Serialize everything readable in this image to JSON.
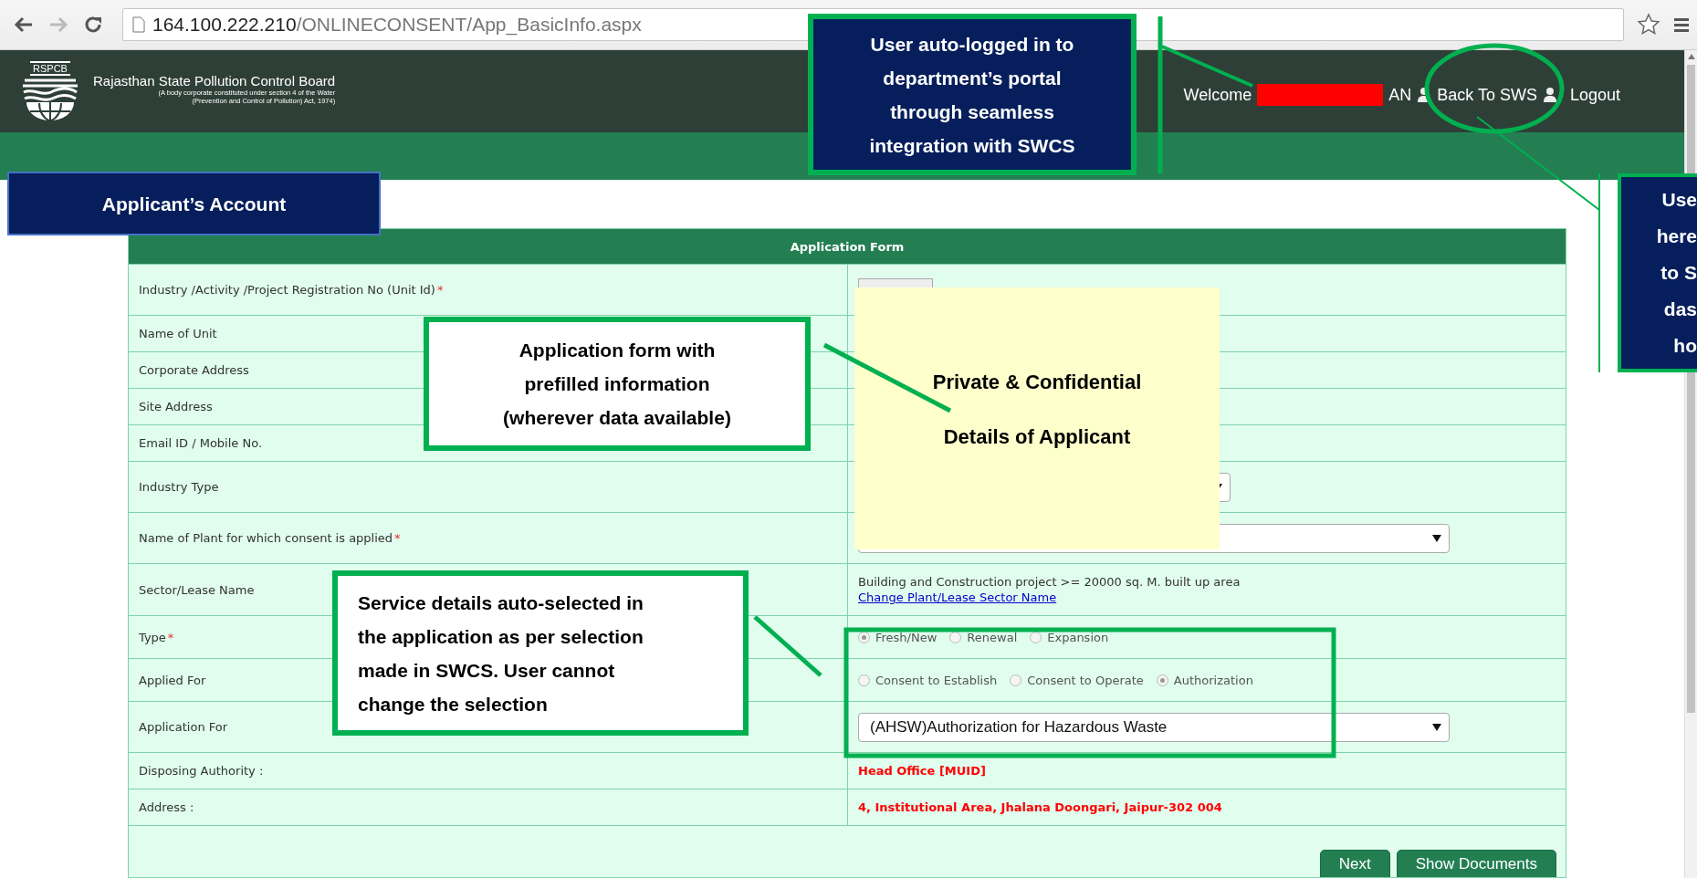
{
  "browser": {
    "url_host": "164.100.222.210",
    "url_path": "/ONLINECONSENT/App_BasicInfo.aspx"
  },
  "header": {
    "logo_text": "RSPCB",
    "org_name": "Rajasthan State Pollution Control Board",
    "org_subtitle_1": "(A body corporate constituted under section 4 of the Water",
    "org_subtitle_2": "(Prevention and Control of Pollution) Act, 1974)",
    "welcome": "Welcome",
    "user_suffix": "AN",
    "back_link": "Back To SWS",
    "logout": "Logout"
  },
  "form": {
    "title": "Application Form",
    "rows": [
      {
        "kind": "input",
        "label": "Industry /Activity /Project Registration No (Unit Id)",
        "required_mark": "*"
      },
      {
        "kind": "blank",
        "label": "Name of Unit"
      },
      {
        "kind": "blank",
        "label": "Corporate Address"
      },
      {
        "kind": "blank",
        "label": "Site Address"
      },
      {
        "kind": "blank",
        "label": "Email ID / Mobile No."
      },
      {
        "kind": "select_short",
        "label": "Industry Type"
      },
      {
        "kind": "select",
        "label": "Name of Plant for which consent is applied",
        "required_mark": "*"
      },
      {
        "kind": "sector",
        "label": "Sector/Lease Name",
        "text": "Building and Construction project >= 20000 sq. M. built up area",
        "link": "Change Plant/Lease Sector Name"
      },
      {
        "kind": "radios",
        "label": "Type",
        "required_mark": "*",
        "options": [
          {
            "label": "Fresh/New",
            "selected": true,
            "disabled": true
          },
          {
            "label": "Renewal",
            "selected": false,
            "disabled": true
          },
          {
            "label": "Expansion",
            "selected": false,
            "disabled": true
          }
        ]
      },
      {
        "kind": "radios",
        "label": "Applied For",
        "options": [
          {
            "label": "Consent to Establish",
            "selected": false,
            "disabled": true
          },
          {
            "label": "Consent to Operate",
            "selected": false,
            "disabled": true
          },
          {
            "label": "Authorization",
            "selected": true,
            "disabled": true
          }
        ]
      },
      {
        "kind": "select",
        "label": "Application For",
        "value": "(AHSW)Authorization for Hazardous Waste"
      },
      {
        "kind": "highlight",
        "label": "Disposing Authority :",
        "value": "Head Office [MUID]"
      },
      {
        "kind": "highlight",
        "label": "Address :",
        "value": "4, Institutional Area, Jhalana Doongari, Jaipur-302 004"
      }
    ],
    "buttons": [
      "Next",
      "Show Documents"
    ]
  },
  "annotations": [
    {
      "kind": "title-callout",
      "lines": [
        "User auto-logged in to",
        "department’s portal",
        "through seamless",
        "integration with SWCS"
      ]
    },
    {
      "kind": "section-label",
      "lines": [
        "Applicant’s Account"
      ]
    },
    {
      "kind": "edge-callout",
      "lines": [
        "Use",
        "here",
        "to S",
        "das",
        "ho"
      ]
    },
    {
      "kind": "form-callout",
      "lines": [
        "Application form with",
        "prefilled information",
        "(wherever data available)"
      ]
    },
    {
      "kind": "privacy-cover",
      "lines": [
        "Private & Confidential",
        "Details of Applicant"
      ]
    },
    {
      "kind": "service-callout",
      "lines": [
        "Service details auto-selected in",
        "the application as per selection",
        "made in SWCS. User cannot",
        "change the selection"
      ]
    }
  ]
}
